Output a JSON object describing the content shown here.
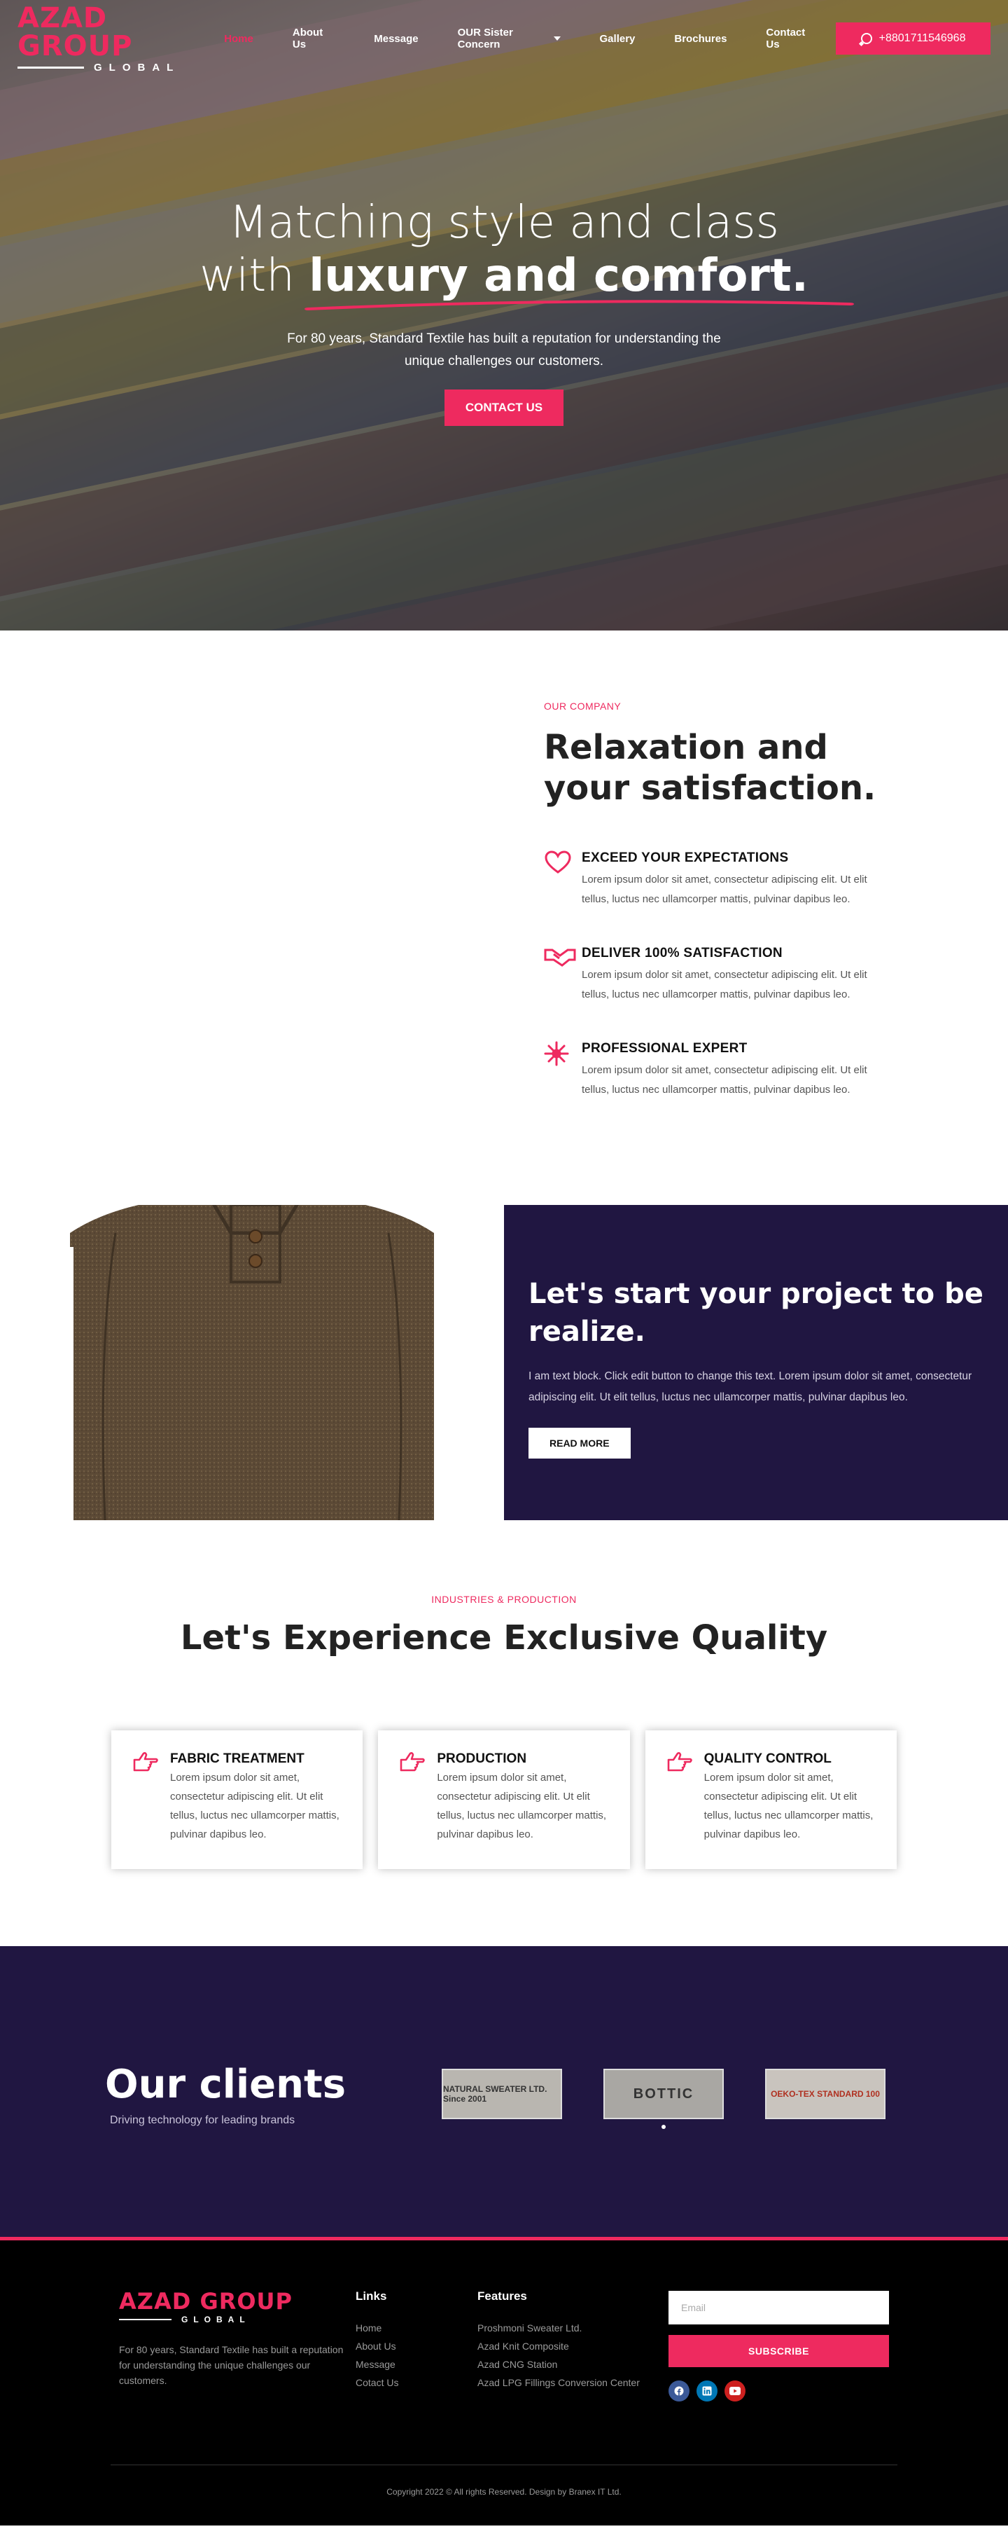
{
  "header": {
    "logo_main": "AZAD GROUP",
    "logo_sub": "GLOBAL",
    "nav": [
      {
        "label": "Home"
      },
      {
        "label": "About Us"
      },
      {
        "label": "Message"
      },
      {
        "label": "OUR Sister Concern"
      },
      {
        "label": "Gallery"
      },
      {
        "label": "Brochures"
      },
      {
        "label": "Contact Us"
      }
    ],
    "phone": "+8801711546968"
  },
  "hero": {
    "line1": "Matching style and class",
    "line2_prefix": "with",
    "line2_bold": "luxury and comfort.",
    "paragraph": "For 80 years, Standard Textile has built a reputation for understanding the unique challenges our customers.",
    "button": "CONTACT US"
  },
  "company": {
    "kicker": "OUR COMPANY",
    "title": "Relaxation and your satisfaction.",
    "features": [
      {
        "icon": "heart-icon",
        "title": "EXCEED YOUR EXPECTATIONS",
        "text": "Lorem ipsum dolor sit amet, consectetur adipiscing elit. Ut elit tellus, luctus nec ullamcorper mattis, pulvinar dapibus leo."
      },
      {
        "icon": "handshake-icon",
        "title": "DELIVER 100% SATISFACTION",
        "text": "Lorem ipsum dolor sit amet, consectetur adipiscing elit. Ut elit tellus, luctus nec ullamcorper mattis, pulvinar dapibus leo."
      },
      {
        "icon": "snowflake-icon",
        "title": "PROFESSIONAL EXPERT",
        "text": "Lorem ipsum dolor sit amet, consectetur adipiscing elit. Ut elit tellus, luctus nec ullamcorper mattis, pulvinar dapibus leo."
      }
    ]
  },
  "project": {
    "title": "Let's start your project to be realize.",
    "text": "I am text block. Click edit button to change this text. Lorem ipsum dolor sit amet, consectetur adipiscing elit. Ut elit tellus, luctus nec ullamcorper mattis, pulvinar dapibus leo.",
    "button": "READ MORE"
  },
  "quality": {
    "kicker": "INDUSTRIES & PRODUCTION",
    "title": "Let's Experience Exclusive Quality",
    "cards": [
      {
        "icon": "hand-point-right-icon",
        "title": "FABRIC TREATMENT",
        "text": "Lorem ipsum dolor sit amet, consectetur adipiscing elit. Ut elit tellus, luctus nec ullamcorper mattis, pulvinar dapibus leo."
      },
      {
        "icon": "hand-point-right-icon",
        "title": "PRODUCTION",
        "text": "Lorem ipsum dolor sit amet, consectetur adipiscing elit. Ut elit tellus, luctus nec ullamcorper mattis, pulvinar dapibus leo."
      },
      {
        "icon": "hand-point-right-icon",
        "title": "QUALITY CONTROL",
        "text": "Lorem ipsum dolor sit amet, consectetur adipiscing elit. Ut elit tellus, luctus nec ullamcorper mattis, pulvinar dapibus leo."
      }
    ]
  },
  "clients": {
    "title": "Our clients",
    "subtitle": "Driving technology for leading brands",
    "logos": [
      "NATURAL SWEATER LTD. Since 2001",
      "BOTTIC",
      "OEKO-TEX STANDARD 100"
    ]
  },
  "footer": {
    "logo_main": "AZAD GROUP",
    "logo_sub": "GLOBAL",
    "about": "For 80 years, Standard Textile has built a reputation for understanding the unique challenges our customers.",
    "links_title": "Links",
    "links": [
      "Home",
      "About Us",
      "Message",
      "Cotact Us"
    ],
    "features_title": "Features",
    "features": [
      "Proshmoni Sweater Ltd.",
      "Azad Knit Composite",
      "Azad CNG Station",
      "Azad LPG Fillings Conversion Center"
    ],
    "email_placeholder": "Email",
    "subscribe": "SUBSCRIBE",
    "socials": [
      "facebook-icon",
      "linkedin-icon",
      "youtube-icon"
    ],
    "copyright": "Copyright 2022 © All rights Reserved. Design by Branex IT Ltd."
  },
  "colors": {
    "accent": "#ee2a5f",
    "dark_purple": "#201641",
    "footer_bg": "#000000"
  }
}
